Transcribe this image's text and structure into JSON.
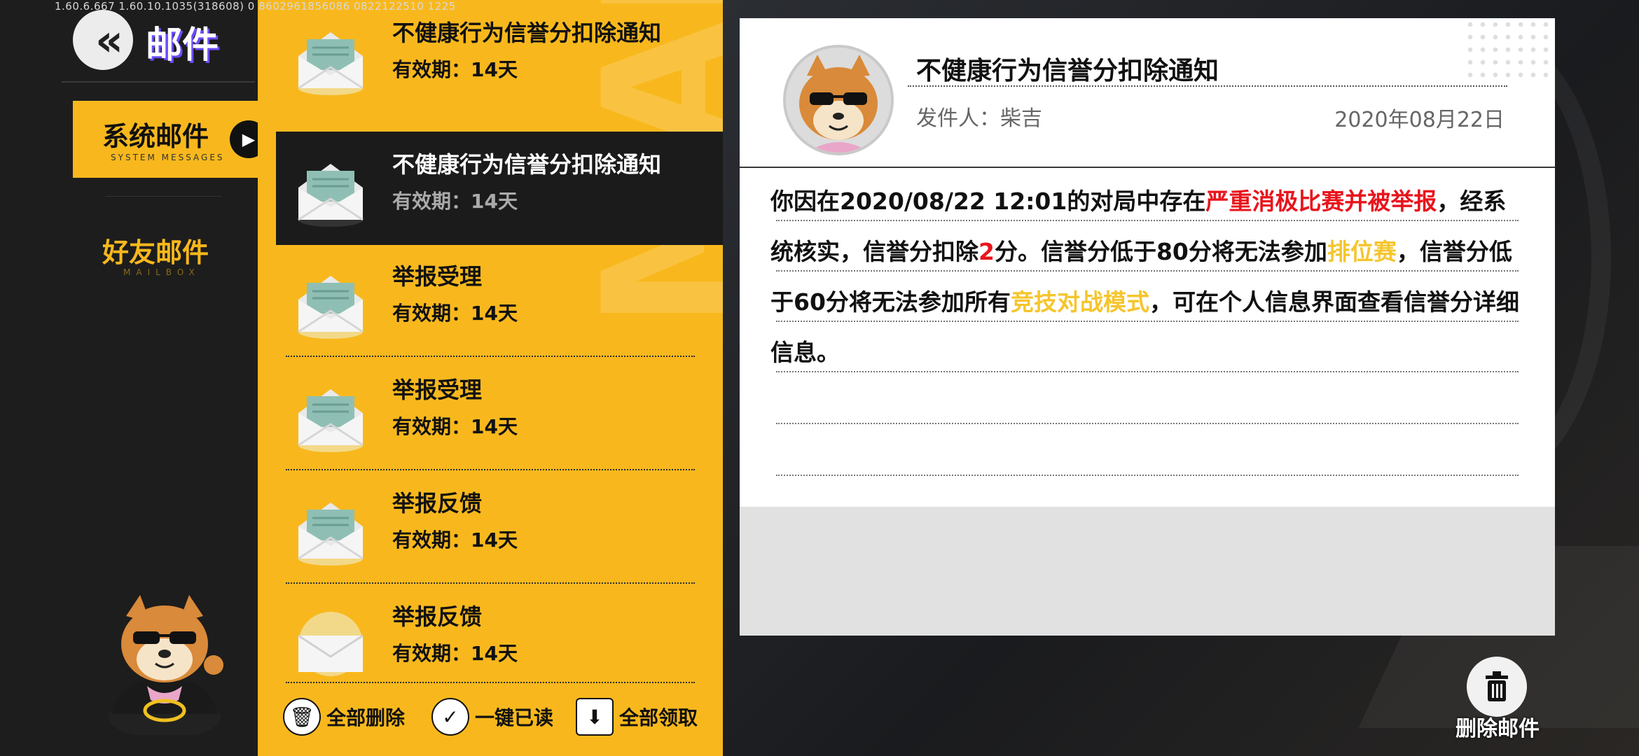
{
  "version_text": "1.60.6.667  1.60.10.1035(318608)  0  8602961856086   0822122510 1225",
  "header": {
    "back_icon": "double-chevron-left-icon",
    "title": "邮件"
  },
  "sidebar": {
    "tabs": [
      {
        "label": "系统邮件",
        "sub": "SYSTEM MESSAGES",
        "active": true
      },
      {
        "label": "好友邮件",
        "sub": "MAILBOX",
        "active": false
      }
    ]
  },
  "mail_list": {
    "watermark": "MAIL",
    "items": [
      {
        "subject": "不健康行为信誉分扣除通知",
        "validity": "有效期：14天",
        "opened": true,
        "selected": false
      },
      {
        "subject": "不健康行为信誉分扣除通知",
        "validity": "有效期：14天",
        "opened": true,
        "selected": true
      },
      {
        "subject": "举报受理",
        "validity": "有效期：14天",
        "opened": true,
        "selected": false
      },
      {
        "subject": "举报受理",
        "validity": "有效期：14天",
        "opened": true,
        "selected": false
      },
      {
        "subject": "举报反馈",
        "validity": "有效期：14天",
        "opened": true,
        "selected": false
      },
      {
        "subject": "举报反馈",
        "validity": "有效期：14天",
        "opened": false,
        "selected": false
      }
    ],
    "actions": [
      {
        "label": "全部删除",
        "icon": "trash-icon"
      },
      {
        "label": "一键已读",
        "icon": "check-icon"
      },
      {
        "label": "全部领取",
        "icon": "download-icon"
      }
    ]
  },
  "detail": {
    "title": "不健康行为信誉分扣除通知",
    "sender": "发件人：柴吉",
    "date": "2020年08月22日",
    "body": {
      "p1": "你因在2020/08/22 12:01的对局中存在",
      "h1": "严重消极比赛并被举报",
      "p2": "，经系统核实，信誉分扣除",
      "h2": "2",
      "p3": "分。信誉分低于80分将无法参加",
      "h3": "排位赛",
      "p4": "，信誉分低于60分将无法参加所有",
      "h4": "竞技对战模式",
      "p5": "，可在个人信息界面查看信誉分详细信息。"
    }
  },
  "delete_mail": {
    "label": "删除邮件",
    "icon": "trash-icon"
  },
  "colors": {
    "accent": "#f8b81d",
    "highlight_red": "#e8141c",
    "highlight_yellow": "#f5c52c"
  }
}
